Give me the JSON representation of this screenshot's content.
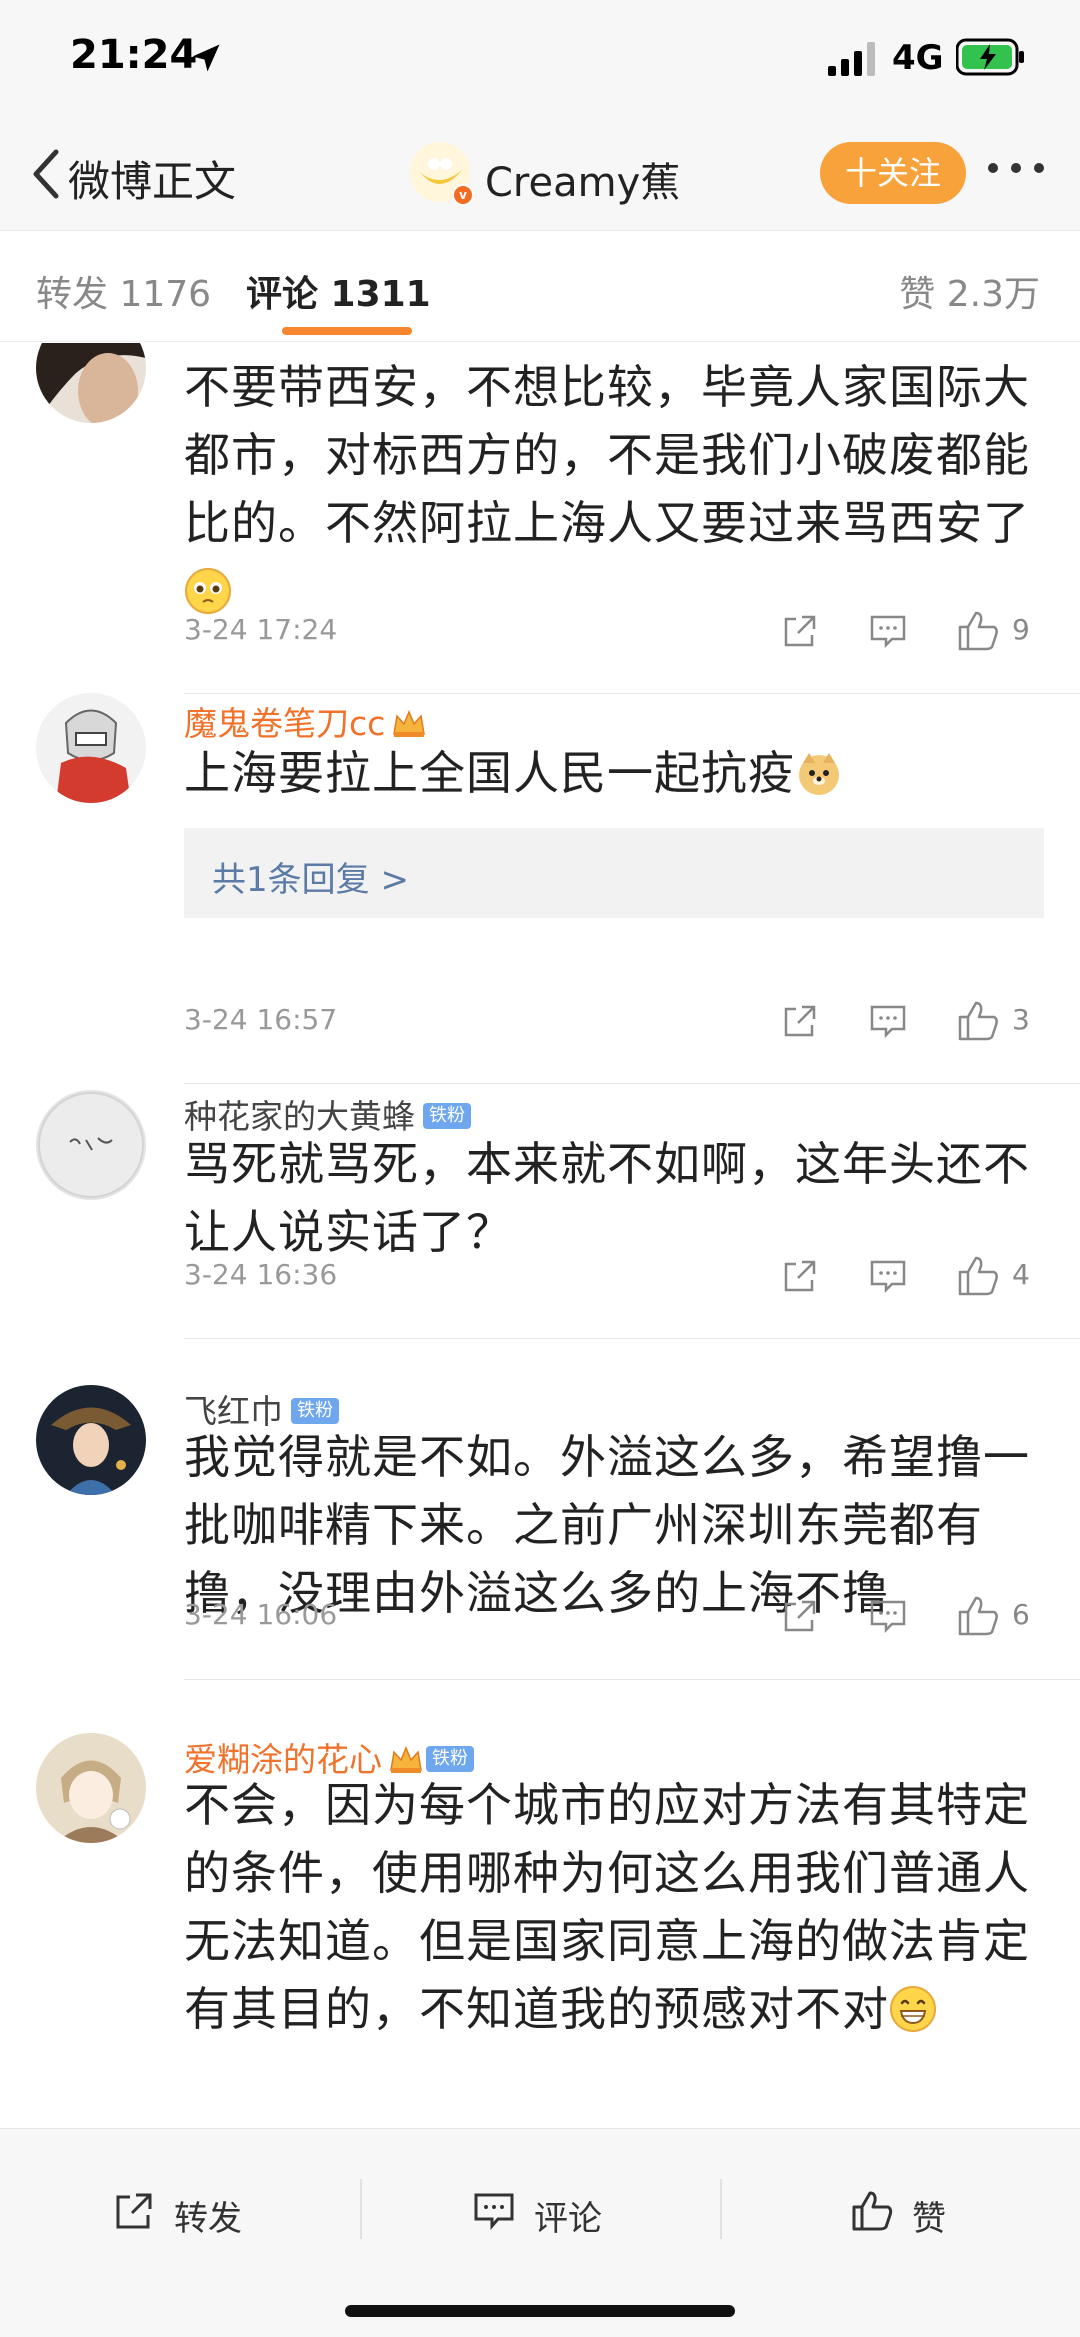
{
  "status_bar": {
    "time": "21:24",
    "network": "4G"
  },
  "nav": {
    "back_label": "微博正文",
    "username": "Creamy蕉",
    "follow_label": "十关注"
  },
  "tabs": {
    "repost": "转发 1176",
    "comment": "评论 1311",
    "like": "赞 2.3万"
  },
  "comments": [
    {
      "text": "不要带西安，不想比较，毕竟人家国际大都市，对标西方的，不是我们小破废都能比的。不然阿拉上海人又要过来骂西安了",
      "emoji": "pleading-face-emoji",
      "date": "3-24 17:24",
      "likes": "9"
    },
    {
      "username": "魔鬼卷笔刀cc",
      "text": "上海要拉上全国人民一起抗疫",
      "emoji": "doge-emoji",
      "reply_summary": "共1条回复 >",
      "date": "3-24 16:57",
      "likes": "3"
    },
    {
      "username": "种花家的大黄蜂",
      "badge": "铁粉",
      "text": "骂死就骂死，本来就不如啊，这年头还不让人说实话了？",
      "date": "3-24 16:36",
      "likes": "4"
    },
    {
      "username": "飞红巾",
      "badge": "铁粉",
      "text": "我觉得就是不如。外溢这么多，希望撸一批咖啡精下来。之前广州深圳东莞都有撸，没理由外溢这么多的上海不撸",
      "date": "3-24 16:06",
      "likes": "6"
    },
    {
      "username": "爱糊涂的花心",
      "badge": "铁粉",
      "text": "不会，因为每个城市的应对方法有其特定的条件，使用哪种为何这么用我们普通人无法知道。但是国家同意上海的做法肯定有其目的，不知道我的预感对不对",
      "emoji": "grinning-face-emoji"
    }
  ],
  "bottom_bar": {
    "repost": "转发",
    "comment": "评论",
    "like": "赞"
  },
  "colors": {
    "accent": "#f7862e",
    "follow": "#f7a23a",
    "link": "#5b7ba6",
    "fan_badge": "#6fa7ee"
  }
}
